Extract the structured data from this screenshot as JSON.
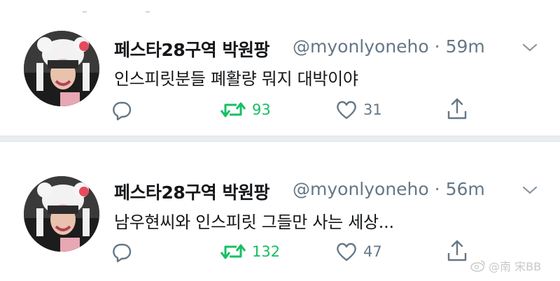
{
  "tweets": [
    {
      "name": "페스타28구역 박원팡",
      "handle": "@myonlyoneho",
      "time": "59m",
      "text": "인스피릿분들 폐활량 뭐지 대박이야",
      "retweets": "93",
      "likes": "31"
    },
    {
      "name": "페스타28구역 박원팡",
      "handle": "@myonlyoneho",
      "time": "56m",
      "text": "남우현씨와 인스피릿 그들만 사는 세상...",
      "retweets": "132",
      "likes": "47"
    }
  ],
  "separator": "·",
  "watermark": "@南 宋BB",
  "colors": {
    "retweet_green": "#17bf63",
    "secondary_gray": "#657786",
    "divider": "#ebeef0"
  },
  "icons": [
    "reply-icon",
    "retweet-icon",
    "like-icon",
    "share-icon",
    "chevron-down-icon"
  ]
}
